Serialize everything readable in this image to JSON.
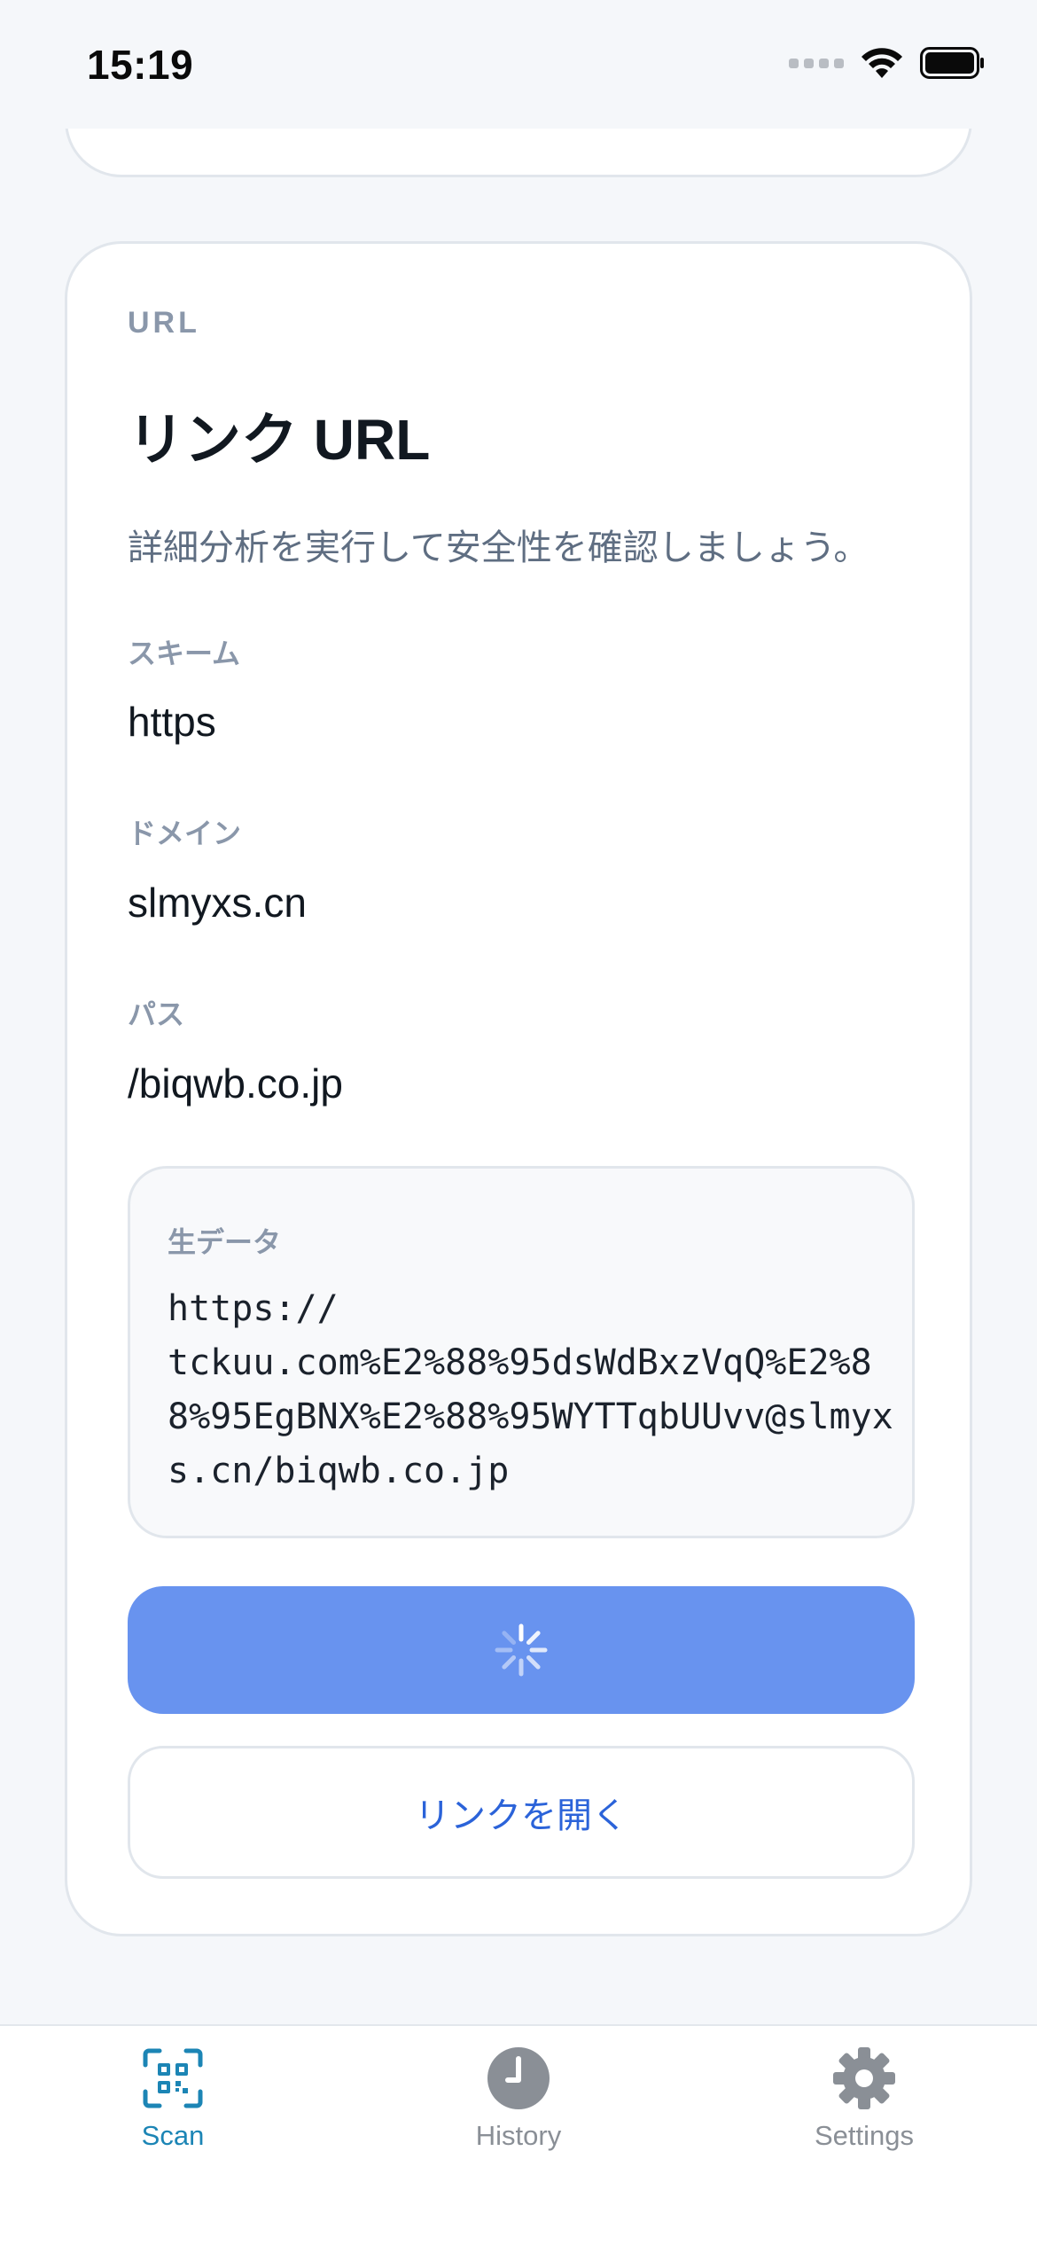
{
  "status_bar": {
    "time": "15:19"
  },
  "card": {
    "eyebrow": "URL",
    "title": "リンク URL",
    "subtitle": "詳細分析を実行して安全性を確認しましょう。",
    "fields": [
      {
        "label": "スキーム",
        "value": "https"
      },
      {
        "label": "ドメイン",
        "value": "slmyxs.cn"
      },
      {
        "label": "パス",
        "value": "/biqwb.co.jp"
      }
    ],
    "raw": {
      "label": "生データ",
      "value": "https://\ntckuu.com%E2%88%95dsWdBxzVqQ%E2%88%95EgBNX%E2%88%95WYTTqbUUvv@slmyxs.cn/biqwb.co.jp"
    },
    "primary_button": {
      "state": "loading"
    },
    "secondary_button": {
      "label": "リンクを開く"
    }
  },
  "tabs": [
    {
      "label": "Scan",
      "icon": "qr-scan-icon",
      "active": true
    },
    {
      "label": "History",
      "icon": "clock-icon",
      "active": false
    },
    {
      "label": "Settings",
      "icon": "gear-icon",
      "active": false
    }
  ],
  "colors": {
    "accent": "#6893ef",
    "link": "#2b63d9",
    "tab_active": "#1c85b5",
    "tab_inactive": "#8a8f96"
  }
}
